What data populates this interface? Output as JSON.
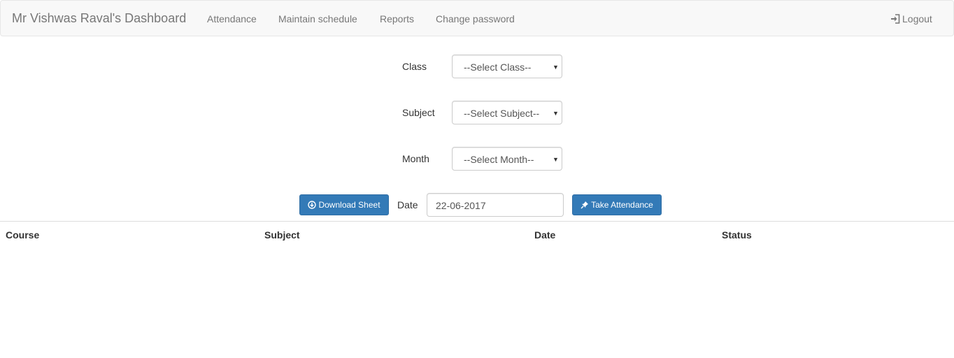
{
  "navbar": {
    "brand": "Mr Vishwas Raval's Dashboard",
    "links": [
      "Attendance",
      "Maintain schedule",
      "Reports",
      "Change password"
    ],
    "logout_label": "Logout",
    "logout_icon": "log-in-icon"
  },
  "form": {
    "class": {
      "label": "Class",
      "selected": "--Select Class--"
    },
    "subject": {
      "label": "Subject",
      "selected": "--Select Subject--"
    },
    "month": {
      "label": "Month",
      "selected": "--Select Month--"
    }
  },
  "actions": {
    "download_label": "Download Sheet",
    "download_icon": "download-circle-icon",
    "date_label": "Date",
    "date_value": "22-06-2017",
    "take_attendance_label": "Take Attendance",
    "take_attendance_icon": "pushpin-icon"
  },
  "table": {
    "headers": [
      "Course",
      "Subject",
      "Date",
      "Status"
    ],
    "rows": []
  },
  "colors": {
    "primary": "#337ab7",
    "navbar_bg": "#f8f8f8",
    "nav_text": "#777777"
  }
}
